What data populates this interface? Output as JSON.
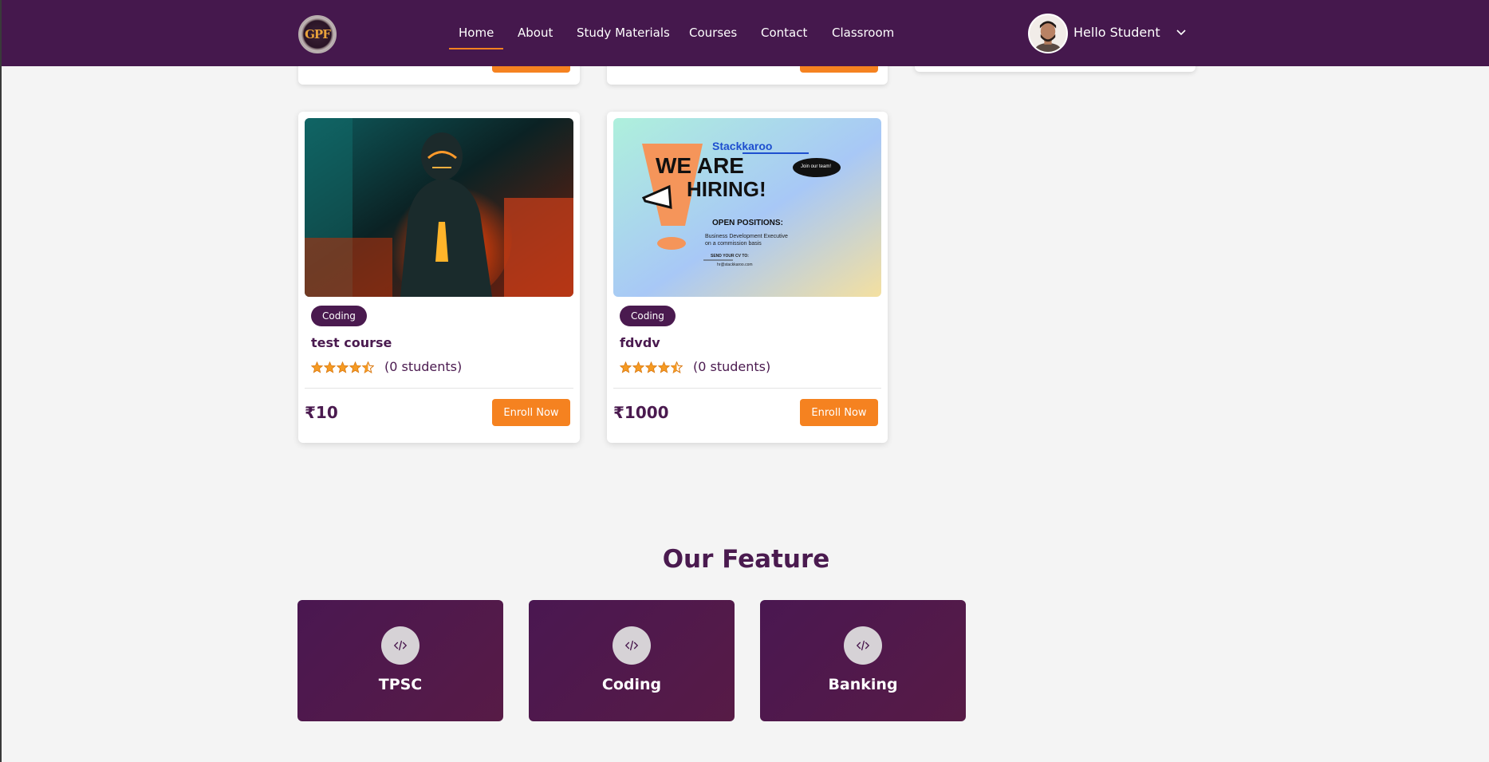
{
  "nav": {
    "logo_text": "GPF",
    "links": [
      {
        "label": "Home",
        "active": true
      },
      {
        "label": "About"
      },
      {
        "label": "Study Materials"
      },
      {
        "label": "Courses"
      },
      {
        "label": "Contact"
      },
      {
        "label": "Classroom"
      }
    ],
    "user_greeting": "Hello Student"
  },
  "courses": [
    {
      "category": "Coding",
      "title": "test course",
      "rating": 4.5,
      "students": "(0 students)",
      "price": "₹10",
      "enroll_label": "Enroll Now"
    },
    {
      "category": "Coding",
      "title": "fdvdv",
      "rating": 4.5,
      "students": "(0 students)",
      "price": "₹1000",
      "enroll_label": "Enroll Now",
      "image_text": {
        "brand": "Stackkaroo",
        "headline_1": "WE ARE",
        "headline_2": "HIRING!",
        "bubble": "Join our team!",
        "positions_heading": "OPEN POSITIONS:",
        "position_1": "Business Development Executive",
        "position_2": "on a commission basis",
        "cv_heading": "SEND YOUR CV TO:",
        "cv_email": "hr@stackkaroo.com"
      }
    }
  ],
  "features": {
    "title": "Our Feature",
    "items": [
      {
        "label": "TPSC",
        "icon": "code-icon"
      },
      {
        "label": "Coding",
        "icon": "code-icon"
      },
      {
        "label": "Banking",
        "icon": "code-icon"
      }
    ]
  },
  "colors": {
    "nav_bg": "#45184d",
    "accent": "#f58220",
    "primary_text": "#4a1a4f"
  }
}
